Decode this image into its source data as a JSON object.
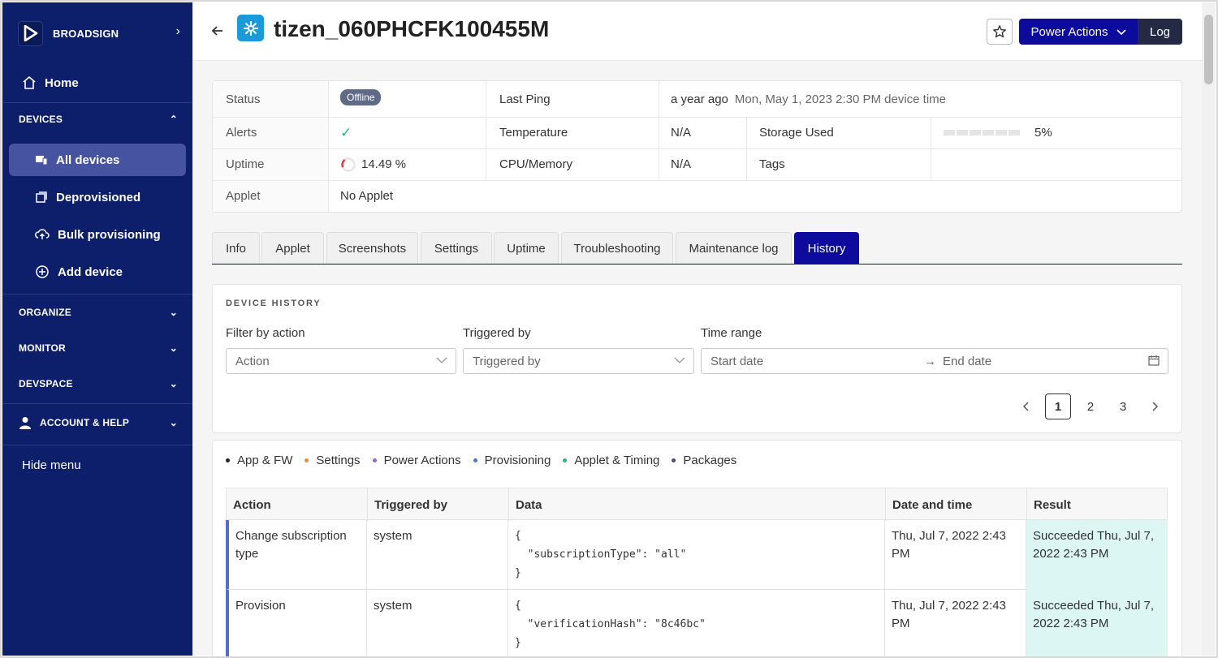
{
  "sidebar": {
    "brand": "BROADSIGN",
    "home": "Home",
    "devices_section": "DEVICES",
    "items": [
      {
        "label": "All devices"
      },
      {
        "label": "Deprovisioned"
      },
      {
        "label": "Bulk provisioning"
      },
      {
        "label": "Add device"
      }
    ],
    "organize": "ORGANIZE",
    "monitor": "MONITOR",
    "devspace": "DEVSPACE",
    "account": "ACCOUNT & HELP",
    "hide_menu": "Hide menu"
  },
  "header": {
    "device_name": "tizen_060PHCFK100455M",
    "power_actions": "Power Actions",
    "log": "Log"
  },
  "info": {
    "status_label": "Status",
    "status_value": "Offline",
    "last_ping_label": "Last Ping",
    "last_ping_value": "a year ago",
    "last_ping_detail": "Mon, May 1, 2023 2:30 PM device time",
    "alerts_label": "Alerts",
    "alerts_value": "✓",
    "temperature_label": "Temperature",
    "temperature_value": "N/A",
    "storage_label": "Storage Used",
    "storage_value": "5%",
    "uptime_label": "Uptime",
    "uptime_value": "14.49 %",
    "cpu_label": "CPU/Memory",
    "cpu_value": "N/A",
    "tags_label": "Tags",
    "applet_label": "Applet",
    "applet_value": "No Applet"
  },
  "tabs": [
    {
      "label": "Info"
    },
    {
      "label": "Applet"
    },
    {
      "label": "Screenshots"
    },
    {
      "label": "Settings"
    },
    {
      "label": "Uptime"
    },
    {
      "label": "Troubleshooting"
    },
    {
      "label": "Maintenance log"
    },
    {
      "label": "History"
    }
  ],
  "history": {
    "title": "DEVICE HISTORY",
    "filter_action_label": "Filter by action",
    "filter_action_placeholder": "Action",
    "triggered_label": "Triggered by",
    "triggered_placeholder": "Triggered by",
    "time_label": "Time range",
    "start_placeholder": "Start date",
    "end_placeholder": "End date",
    "pages": [
      "1",
      "2",
      "3"
    ],
    "current_page": "1"
  },
  "legend": [
    {
      "label": "App & FW",
      "color": "#222222"
    },
    {
      "label": "Settings",
      "color": "#f08a3c"
    },
    {
      "label": "Power Actions",
      "color": "#9b5ad6"
    },
    {
      "label": "Provisioning",
      "color": "#4a78c8"
    },
    {
      "label": "Applet & Timing",
      "color": "#2bb673"
    },
    {
      "label": "Packages",
      "color": "#4a4f6e"
    }
  ],
  "table": {
    "headers": [
      "Action",
      "Triggered by",
      "Data",
      "Date and time",
      "Result"
    ],
    "rows": [
      {
        "action": "Change subscription type",
        "triggered_by": "system",
        "data": "{\n  \"subscriptionType\": \"all\"\n}",
        "datetime": "Thu, Jul 7, 2022 2:43 PM",
        "result": "Succeeded Thu, Jul 7, 2022 2:43 PM"
      },
      {
        "action": "Provision",
        "triggered_by": "system",
        "data": "{\n  \"verificationHash\": \"8c46bc\"\n}",
        "datetime": "Thu, Jul 7, 2022 2:43 PM",
        "result": "Succeeded Thu, Jul 7, 2022 2:43 PM"
      }
    ]
  }
}
